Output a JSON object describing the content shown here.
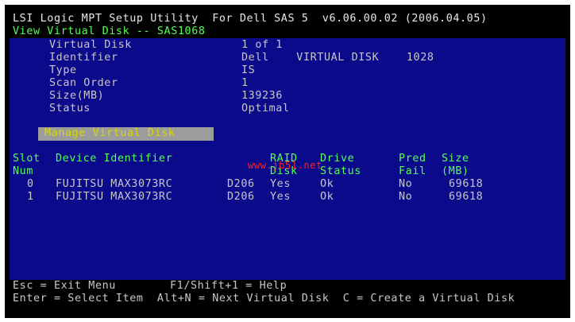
{
  "header": {
    "title": "LSI Logic MPT Setup Utility  For Dell SAS 5  v6.06.00.02 (2006.04.05)",
    "subtitle": "View Virtual Disk -- SAS1068"
  },
  "fields": [
    {
      "label": "Virtual Disk",
      "value": "1 of 1"
    },
    {
      "label": "Identifier",
      "value": "Dell    VIRTUAL DISK    1028"
    },
    {
      "label": "Type",
      "value": "IS"
    },
    {
      "label": "Scan Order",
      "value": "1"
    },
    {
      "label": "Size(MB)",
      "value": "139236"
    },
    {
      "label": "Status",
      "value": "Optimal"
    }
  ],
  "menu": {
    "manage_label": "Manage Virtual Disk"
  },
  "table": {
    "headers": {
      "slot": [
        "Slot",
        "Num"
      ],
      "device": "Device Identifier",
      "raid": [
        "RAID",
        "Disk"
      ],
      "drive": [
        "Drive",
        "Status"
      ],
      "pred": [
        "Pred",
        "Fail"
      ],
      "size": [
        "Size",
        "(MB)"
      ]
    },
    "rows": [
      {
        "slot": "0",
        "device": "FUJITSU MAX3073RC",
        "rev": "D206",
        "raid": "Yes",
        "drive": "Ok",
        "pred": "No",
        "size": "69618"
      },
      {
        "slot": "1",
        "device": "FUJITSU MAX3073RC",
        "rev": "D206",
        "raid": "Yes",
        "drive": "Ok",
        "pred": "No",
        "size": "69618"
      }
    ]
  },
  "watermark": "www.jb51.net",
  "footer": {
    "line1_left": "Esc = Exit Menu",
    "line1_right": "F1/Shift+1 = Help",
    "line2": "Enter = Select Item  Alt+N = Next Virtual Disk  C = Create a Virtual Disk"
  },
  "colors": {
    "background": "#000000",
    "panel": "#0a0a8a",
    "header_green": "#55ff55",
    "menu_highlight": "#9c9c9c",
    "menu_text": "#d8d800",
    "watermark": "#ff2020"
  }
}
